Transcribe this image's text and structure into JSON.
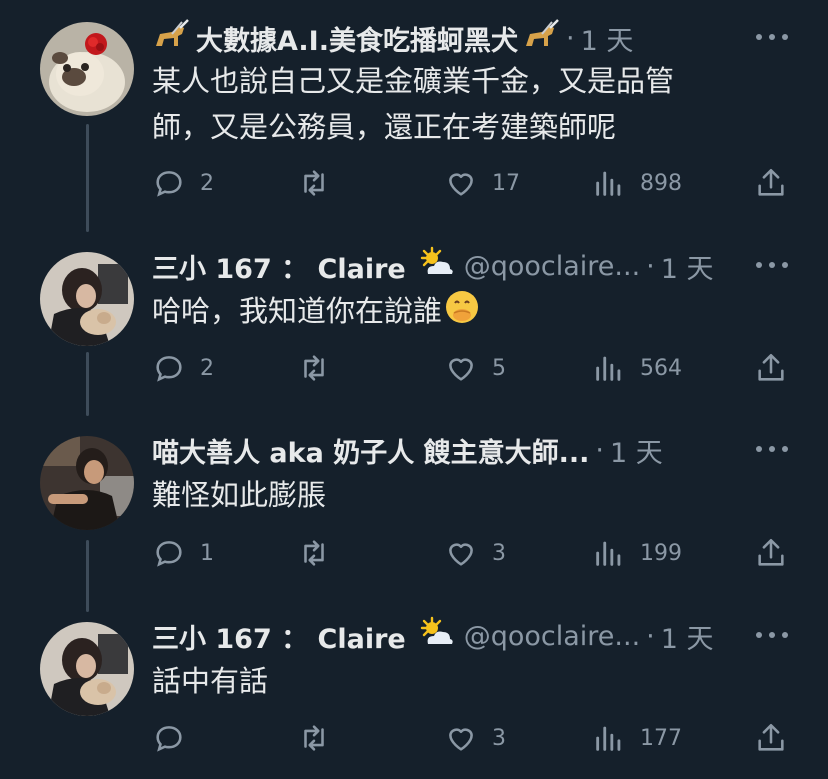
{
  "tweets": [
    {
      "name": "大數據A.I.美食吃播蚵黑犬",
      "handle": "",
      "time": "1 天",
      "lines": [
        "某人也說自己又是金礦業千金，又是品管",
        "師，又是公務員，還正在考建築師呢"
      ],
      "replies": "2",
      "retweets": "",
      "likes": "17",
      "views": "898",
      "avatar": "pug-with-rose"
    },
    {
      "name": "三小 167 ： Claire",
      "handle": "@qooclaire...",
      "time": "1 天",
      "lines": [
        "哈哈，我知道你在說誰"
      ],
      "replies": "2",
      "retweets": "",
      "likes": "5",
      "views": "564",
      "avatar": "woman-with-cat"
    },
    {
      "name": "喵大善人 aka 奶子人 餿主意大師...",
      "handle": "",
      "time": "1 天",
      "lines": [
        "難怪如此膨脹"
      ],
      "replies": "1",
      "retweets": "",
      "likes": "3",
      "views": "199",
      "avatar": "man-photo"
    },
    {
      "name": "三小 167 ： Claire",
      "handle": "@qooclaire...",
      "time": "1 天",
      "lines": [
        "話中有話"
      ],
      "replies": "",
      "retweets": "",
      "likes": "3",
      "views": "177",
      "avatar": "woman-with-cat"
    }
  ],
  "colors": {
    "background": "#15202b",
    "text": "#e7e9ea",
    "muted": "#8b98a5",
    "thread": "#3e4c5a"
  },
  "icons": [
    "guide-dog-icon",
    "sun-behind-cloud-icon",
    "hand-over-mouth-icon",
    "reply-icon",
    "retweet-icon",
    "like-icon",
    "views-icon",
    "share-icon",
    "more-icon"
  ]
}
